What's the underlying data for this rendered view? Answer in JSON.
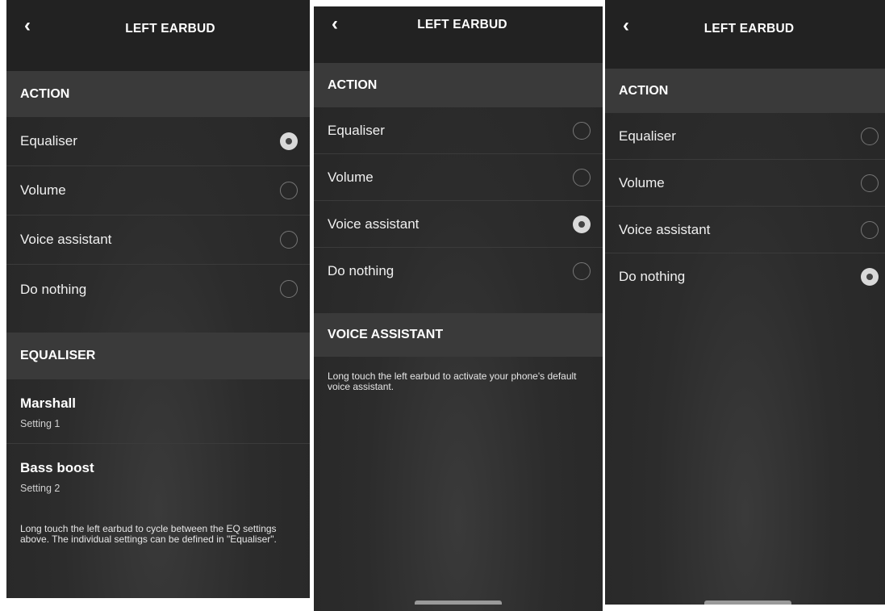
{
  "screens": [
    {
      "header": {
        "title": "LEFT EARBUD",
        "back_icon": "chevron-left-icon"
      },
      "action_section": {
        "title": "ACTION"
      },
      "options": [
        {
          "label": "Equaliser",
          "selected": true
        },
        {
          "label": "Volume",
          "selected": false
        },
        {
          "label": "Voice assistant",
          "selected": false
        },
        {
          "label": "Do nothing",
          "selected": false
        }
      ],
      "detail_section": {
        "title": "EQUALISER"
      },
      "eq_settings": [
        {
          "name": "Marshall",
          "subtitle": "Setting 1"
        },
        {
          "name": "Bass boost",
          "subtitle": "Setting 2"
        }
      ],
      "note": "Long touch the left earbud to cycle between the EQ settings above. The individual settings can be defined in \"Equaliser\"."
    },
    {
      "header": {
        "title": "LEFT EARBUD",
        "back_icon": "chevron-left-icon"
      },
      "action_section": {
        "title": "ACTION"
      },
      "options": [
        {
          "label": "Equaliser",
          "selected": false
        },
        {
          "label": "Volume",
          "selected": false
        },
        {
          "label": "Voice assistant",
          "selected": true
        },
        {
          "label": "Do nothing",
          "selected": false
        }
      ],
      "detail_section": {
        "title": "VOICE ASSISTANT"
      },
      "note": "Long touch the left earbud to activate your phone's default voice assistant."
    },
    {
      "header": {
        "title": "LEFT EARBUD",
        "back_icon": "chevron-left-icon"
      },
      "action_section": {
        "title": "ACTION"
      },
      "options": [
        {
          "label": "Equaliser",
          "selected": false
        },
        {
          "label": "Volume",
          "selected": false
        },
        {
          "label": "Voice assistant",
          "selected": false
        },
        {
          "label": "Do nothing",
          "selected": true
        }
      ]
    }
  ],
  "colors": {
    "background": "#2c2c2c",
    "header": "#222222",
    "section": "#3a3a3a",
    "radio_on": "#d9d9d9"
  }
}
